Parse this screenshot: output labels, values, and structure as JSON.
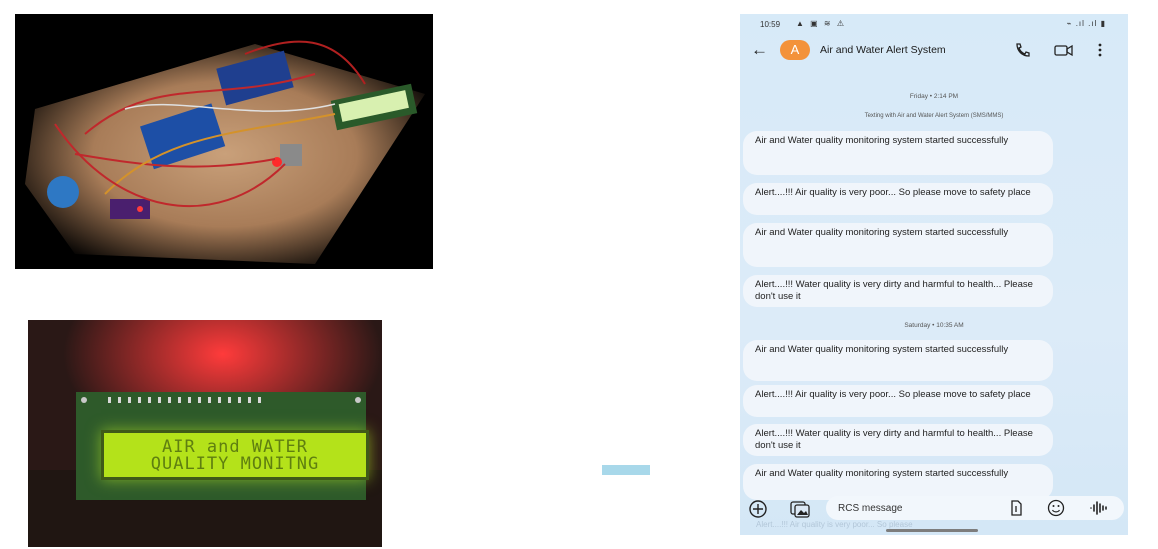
{
  "photos": {
    "lcd_line1": "AIR and WATER",
    "lcd_line2": "QUALITY MONITNG"
  },
  "phone": {
    "status_time": "10:59",
    "status_icons_left": "▲ ▣ ≋ ⚠",
    "status_icons_right": "⌁ .ıl .ıl ▮",
    "contact_initial": "A",
    "contact_name": "Air and Water Alert System",
    "date_separator_1": "Friday • 2:14 PM",
    "sub_separator": "Texting with Air and Water Alert System (SMS/MMS)",
    "date_separator_2": "Saturday • 10:35 AM",
    "messages": [
      "Air and Water quality monitoring system started successfully",
      "Alert....!!! Air quality is very poor... So please move to safety place",
      "Air and Water quality monitoring system started successfully",
      "Alert....!!! Water quality is very dirty and harmful to health... Please don't use it",
      "Air and Water quality monitoring system started successfully",
      "Alert....!!! Air quality is very poor... So please move to safety place",
      "Alert....!!! Water quality is very dirty and harmful to health... Please don't use it",
      "Air and Water quality monitoring system started successfully"
    ],
    "compose_placeholder": "RCS message",
    "faded_message": "Alert....!!! Air quality is very poor... So please"
  },
  "colors": {
    "avatar": "#f3923a",
    "phone_background": "#d7eaf8",
    "bubble": "#f0f5fb",
    "lcd_backlight": "#b4e21a",
    "divider_bar": "#a8d8ea"
  }
}
